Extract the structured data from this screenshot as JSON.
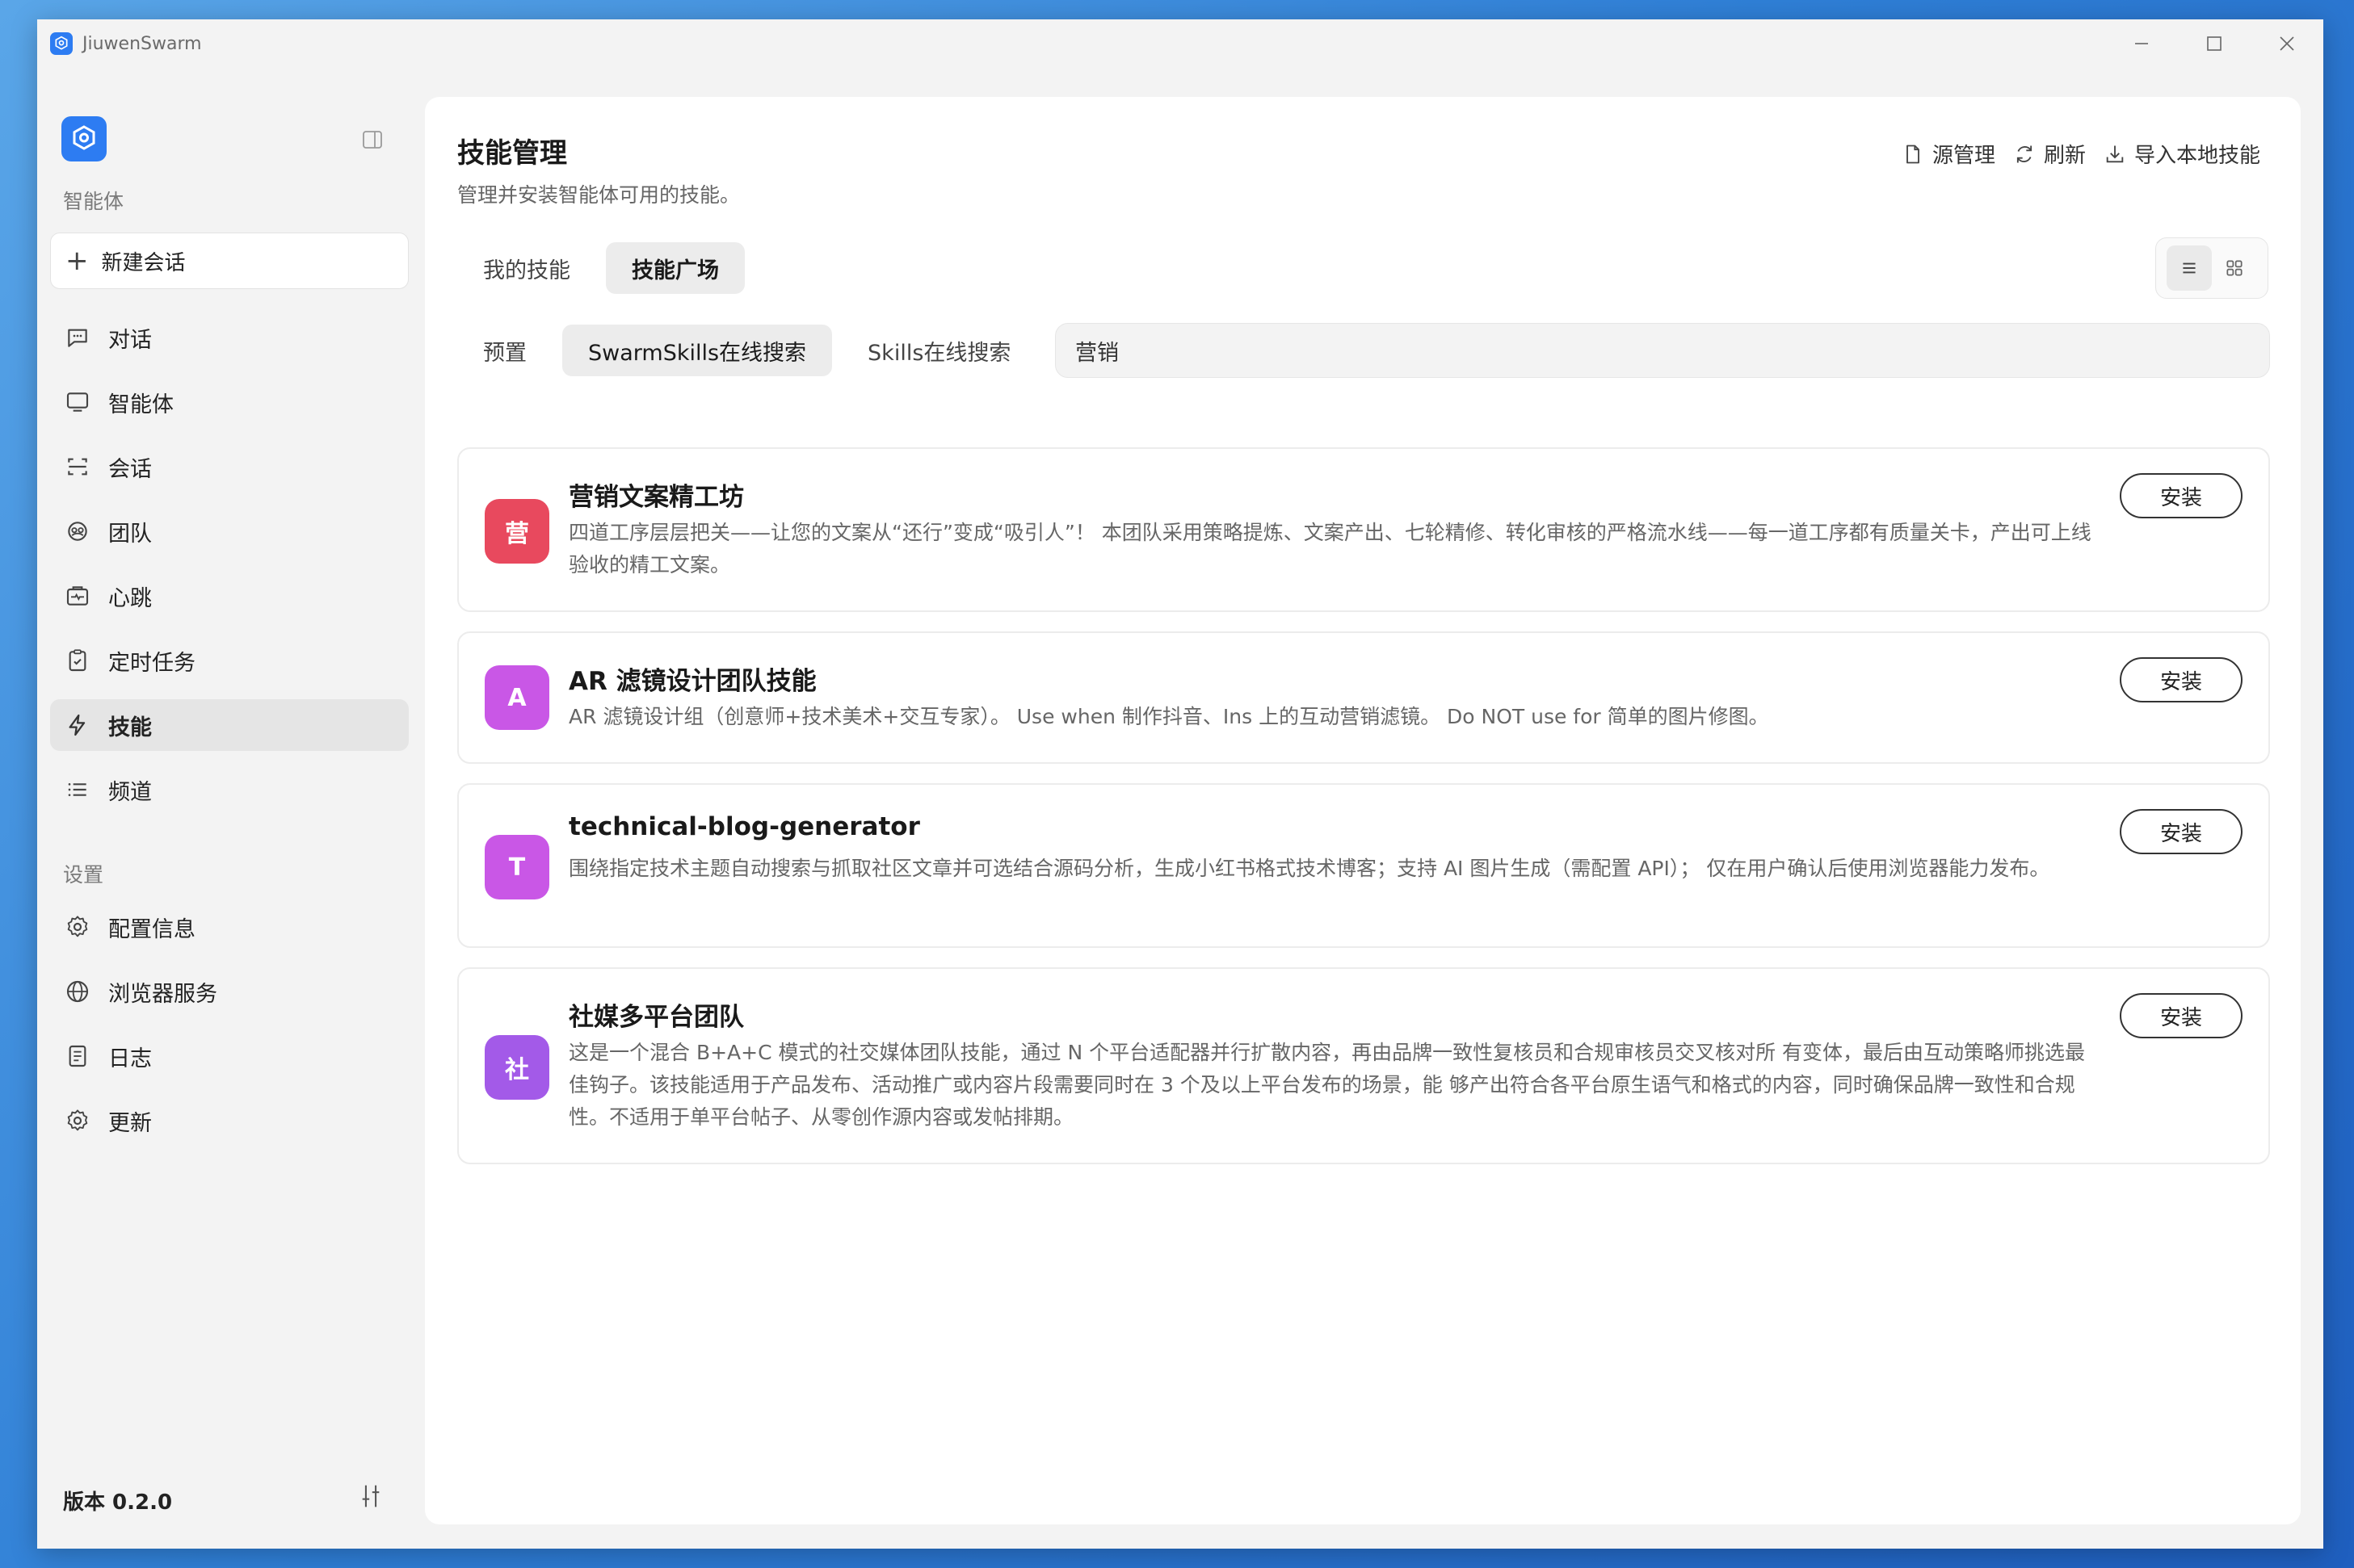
{
  "window": {
    "title": "JiuwenSwarm"
  },
  "sidebar": {
    "section_agent": "智能体",
    "new_chat": "新建会话",
    "nav": [
      {
        "label": "对话",
        "icon": "chat-bubble-icon"
      },
      {
        "label": "智能体",
        "icon": "monitor-icon"
      },
      {
        "label": "会话",
        "icon": "session-frame-icon"
      },
      {
        "label": "团队",
        "icon": "team-icon"
      },
      {
        "label": "心跳",
        "icon": "heartbeat-icon"
      },
      {
        "label": "定时任务",
        "icon": "clipboard-icon"
      },
      {
        "label": "技能",
        "icon": "lightning-icon"
      },
      {
        "label": "频道",
        "icon": "list-icon"
      }
    ],
    "section_settings": "设置",
    "settings": [
      {
        "label": "配置信息",
        "icon": "gear-icon"
      },
      {
        "label": "浏览器服务",
        "icon": "globe-icon"
      },
      {
        "label": "日志",
        "icon": "document-icon"
      },
      {
        "label": "更新",
        "icon": "gear-icon"
      }
    ],
    "version": "版本 0.2.0"
  },
  "header": {
    "title": "技能管理",
    "subtitle": "管理并安装智能体可用的技能。",
    "actions": {
      "source": "源管理",
      "refresh": "刷新",
      "import": "导入本地技能"
    }
  },
  "tabs": [
    {
      "label": "我的技能"
    },
    {
      "label": "技能广场"
    }
  ],
  "subtabs": [
    {
      "label": "预置"
    },
    {
      "label": "SwarmSkills在线搜索"
    },
    {
      "label": "Skills在线搜索"
    }
  ],
  "search": {
    "value": "营销"
  },
  "skills": [
    {
      "avatar": "营",
      "color": "#e8495e",
      "name": "营销文案精工坊",
      "desc": "四道工序层层把关——让您的文案从“还行”变成“吸引人”！ 本团队采用策略提炼、文案产出、七轮精修、转化审核的严格流水线——每一道工序都有质量关卡，产出可上线验收的精工文案。",
      "install": "安装"
    },
    {
      "avatar": "A",
      "color": "#c957e6",
      "name": "AR 滤镜设计团队技能",
      "desc": "AR 滤镜设计组（创意师+技术美术+交互专家）。 Use when 制作抖音、Ins 上的互动营销滤镜。 Do NOT use for 简单的图片修图。",
      "install": "安装"
    },
    {
      "avatar": "T",
      "color": "#c957e6",
      "name": "technical-blog-generator",
      "desc": "围绕指定技术主题自动搜索与抓取社区文章并可选结合源码分析，生成小红书格式技术博客；支持 AI 图片生成（需配置 API）； 仅在用户确认后使用浏览器能力发布。",
      "install": "安装"
    },
    {
      "avatar": "社",
      "color": "#a35ae8",
      "name": "社媒多平台团队",
      "desc": "这是一个混合 B+A+C 模式的社交媒体团队技能，通过 N 个平台适配器并行扩散内容，再由品牌一致性复核员和合规审核员交叉核对所 有变体，最后由互动策略师挑选最佳钩子。该技能适用于产品发布、活动推广或内容片段需要同时在 3 个及以上平台发布的场景，能 够产出符合各平台原生语气和格式的内容，同时确保品牌一致性和合规性。不适用于单平台帖子、从零创作源内容或发帖排期。",
      "install": "安装"
    }
  ]
}
